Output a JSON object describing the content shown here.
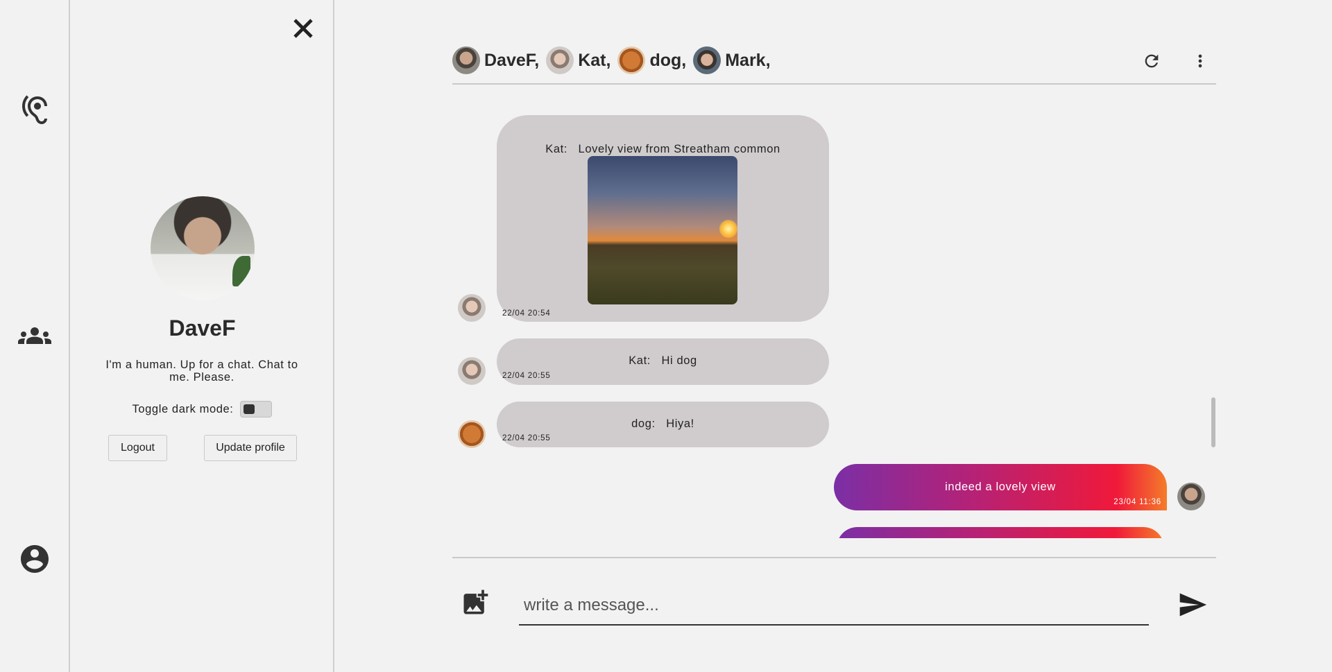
{
  "rail": {
    "items": [
      {
        "icon": "hearing-icon"
      },
      {
        "icon": "groups-icon"
      },
      {
        "icon": "account-circle-icon"
      }
    ]
  },
  "profile": {
    "name": "DaveF",
    "bio": "I'm a human. Up for a chat. Chat to me. Please.",
    "dark_mode_label": "Toggle dark mode:",
    "logout_label": "Logout",
    "update_label": "Update profile"
  },
  "header": {
    "participants": [
      {
        "name": "DaveF,",
        "color": "#5a5550"
      },
      {
        "name": "Kat,",
        "color": "#b9aba2"
      },
      {
        "name": "dog,",
        "color": "#b86a2e"
      },
      {
        "name": "Mark,",
        "color": "#3f3a38"
      }
    ]
  },
  "messages": [
    {
      "sender": "Kat:",
      "text": "Lovely view from Streatham common",
      "time": "22/04 20:54",
      "has_image": true
    },
    {
      "sender": "Kat:",
      "text": "Hi dog",
      "time": "22/04 20:55"
    },
    {
      "sender": "dog:",
      "text": "Hiya!",
      "time": "22/04 20:55"
    },
    {
      "sender": "",
      "text": "indeed a lovely view",
      "time": "23/04 11:36",
      "mine": true
    }
  ],
  "composer": {
    "placeholder": "write a message..."
  },
  "colors": {
    "background": "#f2f2f2",
    "bubble_other": "#d0cccd",
    "bubble_mine_gradient": [
      "#7b2fa5",
      "#b32278",
      "#f0193a",
      "#f47c2a"
    ]
  }
}
